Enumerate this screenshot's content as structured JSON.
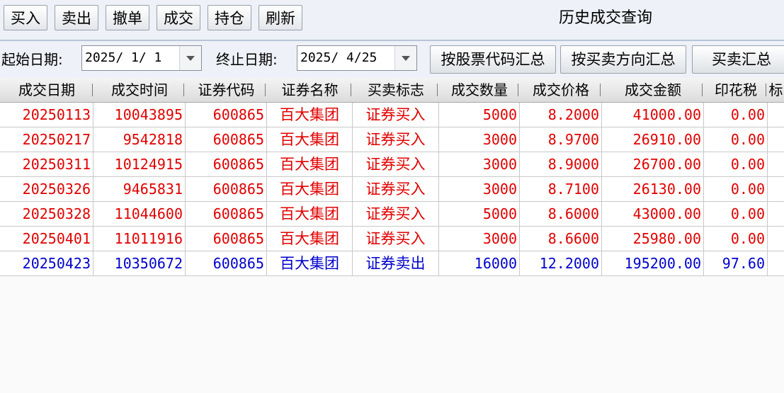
{
  "toolbar": {
    "buttons": [
      "买入",
      "卖出",
      "撤单",
      "成交",
      "持仓",
      "刷新"
    ],
    "title": "历史成交查询"
  },
  "filter": {
    "start_label": "起始日期:",
    "start_value": "2025/ 1/ 1",
    "end_label": "终止日期:",
    "end_value": "2025/ 4/25",
    "btn_by_code": "按股票代码汇总",
    "btn_by_direction": "按买卖方向汇总",
    "btn_summary": "买卖汇总"
  },
  "colors": {
    "buy_text": "#e00000",
    "sell_text": "#0000cc"
  },
  "table": {
    "columns": [
      "成交日期",
      "成交时间",
      "证券代码",
      "证券名称",
      "买卖标志",
      "成交数量",
      "成交价格",
      "成交金额",
      "印花税",
      "标"
    ],
    "rows": [
      {
        "date": "20250113",
        "time": "10043895",
        "code": "600865",
        "name": "百大集团",
        "side": "证券买入",
        "qty": "5000",
        "price": "8.2000",
        "amount": "41000.00",
        "tax": "0.00",
        "type": "buy"
      },
      {
        "date": "20250217",
        "time": "9542818",
        "code": "600865",
        "name": "百大集团",
        "side": "证券买入",
        "qty": "3000",
        "price": "8.9700",
        "amount": "26910.00",
        "tax": "0.00",
        "type": "buy"
      },
      {
        "date": "20250311",
        "time": "10124915",
        "code": "600865",
        "name": "百大集团",
        "side": "证券买入",
        "qty": "3000",
        "price": "8.9000",
        "amount": "26700.00",
        "tax": "0.00",
        "type": "buy"
      },
      {
        "date": "20250326",
        "time": "9465831",
        "code": "600865",
        "name": "百大集团",
        "side": "证券买入",
        "qty": "3000",
        "price": "8.7100",
        "amount": "26130.00",
        "tax": "0.00",
        "type": "buy"
      },
      {
        "date": "20250328",
        "time": "11044600",
        "code": "600865",
        "name": "百大集团",
        "side": "证券买入",
        "qty": "5000",
        "price": "8.6000",
        "amount": "43000.00",
        "tax": "0.00",
        "type": "buy"
      },
      {
        "date": "20250401",
        "time": "11011916",
        "code": "600865",
        "name": "百大集团",
        "side": "证券买入",
        "qty": "3000",
        "price": "8.6600",
        "amount": "25980.00",
        "tax": "0.00",
        "type": "buy"
      },
      {
        "date": "20250423",
        "time": "10350672",
        "code": "600865",
        "name": "百大集团",
        "side": "证券卖出",
        "qty": "16000",
        "price": "12.2000",
        "amount": "195200.00",
        "tax": "97.60",
        "type": "sell"
      }
    ]
  }
}
